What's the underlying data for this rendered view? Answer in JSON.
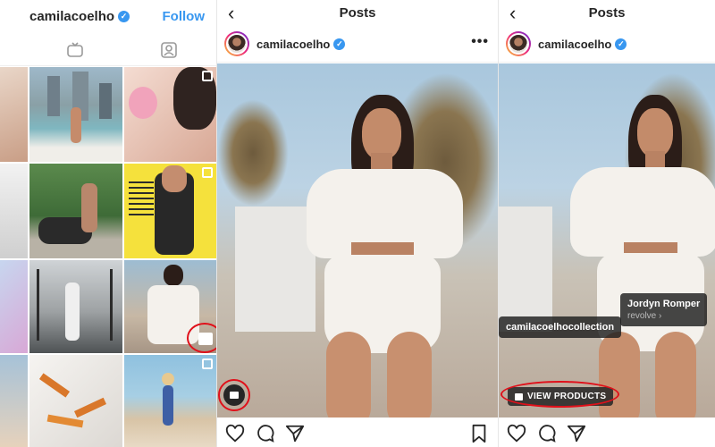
{
  "profile": {
    "username": "camilacoelho",
    "follow_label": "Follow",
    "tabs": [
      {
        "icon": "igtv-icon"
      },
      {
        "icon": "tagged-icon"
      }
    ]
  },
  "post": {
    "header_title": "Posts",
    "username": "camilacoelho",
    "more_label": "•••"
  },
  "tags": {
    "brand": "camilacoelhocollection",
    "product_name": "Jordyn Romper",
    "product_store": "revolve",
    "view_products": "VIEW PRODUCTS"
  },
  "colors": {
    "verified": "#3897f0",
    "follow": "#3897f0",
    "highlight_ring": "#e0101a"
  }
}
